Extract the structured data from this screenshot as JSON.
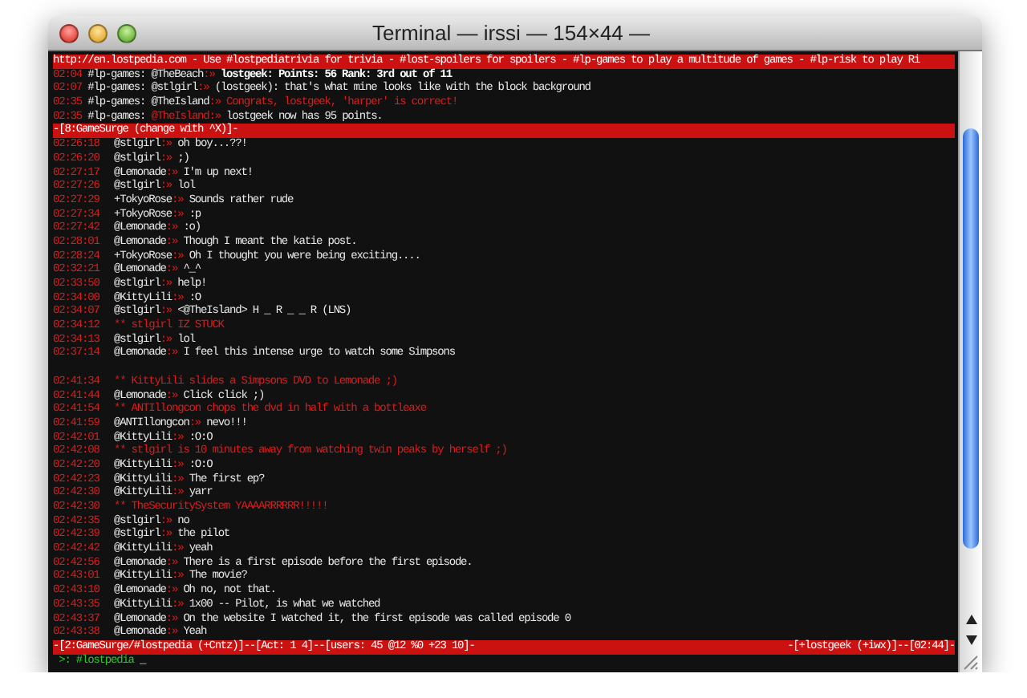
{
  "window": {
    "title": "Terminal — irssi — 154×44 —"
  },
  "topic": "http://en.lostpedia.com - Use #lostpediatrivia for trivia - #lost-spoilers for spoilers - #lp-games to play a multitude of games - #lp-risk to play Ri",
  "hilights": [
    {
      "kind": "bold",
      "time": "02:04",
      "channel": "#lp-games:",
      "nick": "@TheBeach",
      "nick_highlighted": false,
      "sep": ":»",
      "text": "lostgeek: Points: 56 Rank: 3rd out of 11"
    },
    {
      "kind": "plain",
      "time": "02:07",
      "channel": "#lp-games:",
      "nick": "@stlgirl",
      "nick_highlighted": false,
      "sep": ":»",
      "text": "(lostgeek): that's what mine looks like with the block background"
    },
    {
      "kind": "alert",
      "time": "02:35",
      "channel": "#lp-games:",
      "nick": "@TheIsland",
      "nick_highlighted": false,
      "sep": ":»",
      "text": "Congrats, lostgeek, 'harper' is correct!"
    },
    {
      "kind": "plain",
      "time": "02:35",
      "channel": "#lp-games:",
      "nick": "@TheIsland",
      "nick_highlighted": true,
      "sep": ":»",
      "text": "lostgeek now has 95 points."
    }
  ],
  "window_bar": "-[8:GameSurge (change with ^X)]-",
  "lines": [
    {
      "kind": "message",
      "time": "02:26:18",
      "nick": "@stlgirl",
      "sep": ":»",
      "text": "oh boy...??!"
    },
    {
      "kind": "message",
      "time": "02:26:20",
      "nick": "@stlgirl",
      "sep": ":»",
      "text": ";)"
    },
    {
      "kind": "message",
      "time": "02:27:17",
      "nick": "@Lemonade",
      "sep": ":»",
      "text": "I'm up next!"
    },
    {
      "kind": "message",
      "time": "02:27:26",
      "nick": "@stlgirl",
      "sep": ":»",
      "text": "lol"
    },
    {
      "kind": "message",
      "time": "02:27:29",
      "nick": "+TokyoRose",
      "sep": ":»",
      "text": "Sounds rather rude"
    },
    {
      "kind": "message",
      "time": "02:27:34",
      "nick": "+TokyoRose",
      "sep": ":»",
      "text": ":p"
    },
    {
      "kind": "message",
      "time": "02:27:42",
      "nick": "@Lemonade",
      "sep": ":»",
      "text": ":o)"
    },
    {
      "kind": "message",
      "time": "02:28:01",
      "nick": "@Lemonade",
      "sep": ":»",
      "text": "Though I meant the katie post."
    },
    {
      "kind": "message",
      "time": "02:28:24",
      "nick": "+TokyoRose",
      "sep": ":»",
      "text": "Oh I thought you were being exciting...."
    },
    {
      "kind": "message",
      "time": "02:32:21",
      "nick": "@Lemonade",
      "sep": ":»",
      "text": "^_^"
    },
    {
      "kind": "message",
      "time": "02:33:50",
      "nick": "@stlgirl",
      "sep": ":»",
      "text": "help!"
    },
    {
      "kind": "message",
      "time": "02:34:00",
      "nick": "@KittyLili",
      "sep": ":»",
      "text": ":O"
    },
    {
      "kind": "message",
      "time": "02:34:07",
      "nick": "@stlgirl",
      "sep": ":»",
      "text": "<@TheIsland> H _ R _ _ R (LNS)"
    },
    {
      "kind": "action",
      "time": "02:34:12",
      "text": "** stlgirl IZ STUCK"
    },
    {
      "kind": "message",
      "time": "02:34:13",
      "nick": "@stlgirl",
      "sep": ":»",
      "text": "lol"
    },
    {
      "kind": "message",
      "time": "02:37:14",
      "nick": "@Lemonade",
      "sep": ":»",
      "text": "I feel this intense urge to watch some Simpsons"
    },
    {
      "kind": "blank"
    },
    {
      "kind": "action",
      "time": "02:41:34",
      "text": "** KittyLili slides a Simpsons DVD to Lemonade ;)"
    },
    {
      "kind": "message",
      "time": "02:41:44",
      "nick": "@Lemonade",
      "sep": ":»",
      "text": "Click click ;)"
    },
    {
      "kind": "action",
      "time": "02:41:54",
      "text": "** ANTIllongcon chops the dvd in half with a bottleaxe"
    },
    {
      "kind": "message",
      "time": "02:41:59",
      "nick": "@ANTIllongcon",
      "sep": ":»",
      "text": "nevo!!!"
    },
    {
      "kind": "message",
      "time": "02:42:01",
      "nick": "@KittyLili",
      "sep": ":»",
      "text": ":O:O"
    },
    {
      "kind": "action",
      "time": "02:42:08",
      "text": "** stlgirl is 10 minutes away from watching twin peaks by herself ;)"
    },
    {
      "kind": "message",
      "time": "02:42:20",
      "nick": "@KittyLili",
      "sep": ":»",
      "text": ":O:O"
    },
    {
      "kind": "message",
      "time": "02:42:23",
      "nick": "@KittyLili",
      "sep": ":»",
      "text": "The first ep?"
    },
    {
      "kind": "message",
      "time": "02:42:30",
      "nick": "@KittyLili",
      "sep": ":»",
      "text": "yarr"
    },
    {
      "kind": "action",
      "time": "02:42:30",
      "text": "** TheSecuritySystem YAAAARRRRRR!!!!!"
    },
    {
      "kind": "message",
      "time": "02:42:35",
      "nick": "@stlgirl",
      "sep": ":»",
      "text": "no"
    },
    {
      "kind": "message",
      "time": "02:42:39",
      "nick": "@stlgirl",
      "sep": ":»",
      "text": "the pilot"
    },
    {
      "kind": "message",
      "time": "02:42:42",
      "nick": "@KittyLili",
      "sep": ":»",
      "text": "yeah"
    },
    {
      "kind": "message",
      "time": "02:42:56",
      "nick": "@Lemonade",
      "sep": ":»",
      "text": "There is a first episode before the first episode."
    },
    {
      "kind": "message",
      "time": "02:43:01",
      "nick": "@KittyLili",
      "sep": ":»",
      "text": "The movie?"
    },
    {
      "kind": "message",
      "time": "02:43:10",
      "nick": "@Lemonade",
      "sep": ":»",
      "text": "Oh no, not that."
    },
    {
      "kind": "message",
      "time": "02:43:35",
      "nick": "@KittyLili",
      "sep": ":»",
      "text": "1x00 -- Pilot, is what we watched"
    },
    {
      "kind": "message",
      "time": "02:43:37",
      "nick": "@Lemonade",
      "sep": ":»",
      "text": "On the website I watched it, the first episode was called episode 0"
    },
    {
      "kind": "message",
      "time": "02:43:38",
      "nick": "@Lemonade",
      "sep": ":»",
      "text": "Yeah"
    }
  ],
  "statusbar": {
    "left": "-[2:GameSurge/#lostpedia (+Cntz)]--[Act: 1 4]--[users: 45 @12 %0 +23 10]-",
    "right": "-[+lostgeek (+iwx)]--[02:44]-"
  },
  "prompt": {
    "text": ">: #lostpedia",
    "cursor": "_"
  }
}
